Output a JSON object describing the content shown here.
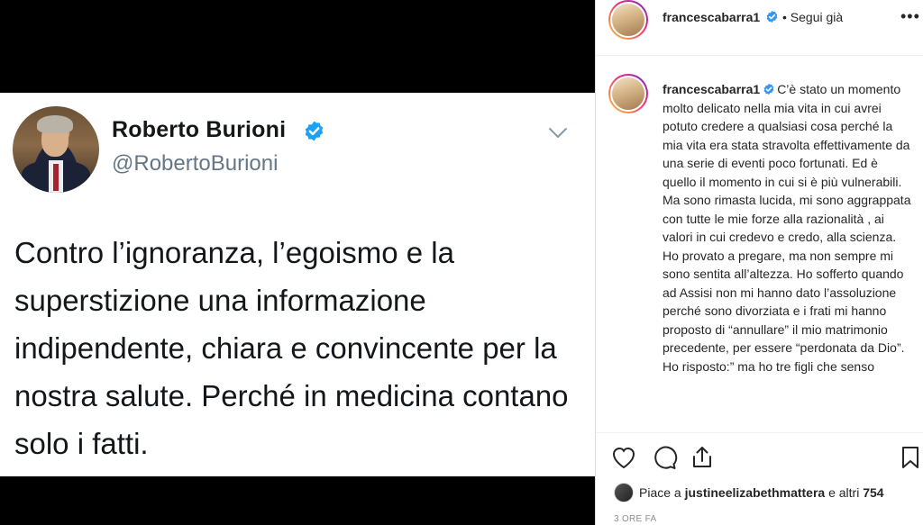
{
  "tweet": {
    "author_name": "Roberto Burioni",
    "handle": "@RobertoBurioni",
    "text": "Contro l’ignoranza, l’egoismo e la superstizione una informazione indipendente, chiara e convincente per la nostra salute. Perché in medicina contano solo i fatti."
  },
  "instagram": {
    "username": "francescabarra1",
    "follow_status": "• Segui già",
    "more_label": "•••",
    "caption": "C’è stato un momento molto delicato nella mia vita in cui avrei potuto credere a qualsiasi cosa perché la mia vita era stata stravolta effettivamente da una serie di eventi poco fortunati. Ed è quello il momento in cui si è più vulnerabili. Ma sono rimasta lucida, mi sono aggrappata con tutte le mie forze alla razionalità , ai valori in cui credevo e credo, alla scienza. Ho provato a pregare, ma non sempre mi sono sentita all’altezza. Ho sofferto quando ad Assisi non mi hanno dato l’assoluzione perché sono divorziata e i frati mi hanno proposto di “annullare” il mio matrimonio precedente, per essere “perdonata da Dio”. Ho risposto:” ma ho tre figli che senso",
    "likes_prefix": "Piace a",
    "likes_user": "justineelizabethmattera",
    "likes_suffix": "e altri",
    "likes_count": "754",
    "timestamp": "3 ORE FA"
  },
  "colors": {
    "twitter_blue": "#1da1f2",
    "instagram_verified": "#3897f0",
    "text_dark": "#14171a",
    "text_gray": "#657786"
  },
  "icons": [
    "verified-badge-icon",
    "chevron-down-icon",
    "heart-icon",
    "comment-icon",
    "share-icon",
    "bookmark-icon",
    "more-options-icon"
  ]
}
